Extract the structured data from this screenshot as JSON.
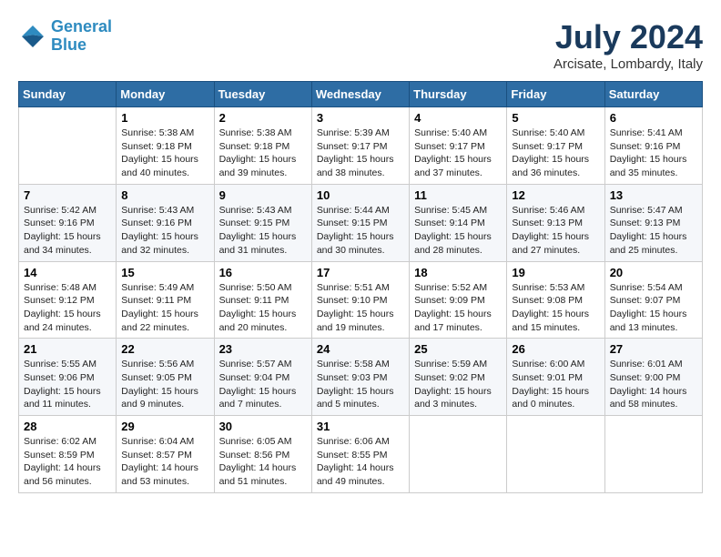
{
  "header": {
    "logo_line1": "General",
    "logo_line2": "Blue",
    "month": "July 2024",
    "location": "Arcisate, Lombardy, Italy"
  },
  "columns": [
    "Sunday",
    "Monday",
    "Tuesday",
    "Wednesday",
    "Thursday",
    "Friday",
    "Saturday"
  ],
  "weeks": [
    [
      {
        "day": "",
        "content": ""
      },
      {
        "day": "1",
        "content": "Sunrise: 5:38 AM\nSunset: 9:18 PM\nDaylight: 15 hours\nand 40 minutes."
      },
      {
        "day": "2",
        "content": "Sunrise: 5:38 AM\nSunset: 9:18 PM\nDaylight: 15 hours\nand 39 minutes."
      },
      {
        "day": "3",
        "content": "Sunrise: 5:39 AM\nSunset: 9:17 PM\nDaylight: 15 hours\nand 38 minutes."
      },
      {
        "day": "4",
        "content": "Sunrise: 5:40 AM\nSunset: 9:17 PM\nDaylight: 15 hours\nand 37 minutes."
      },
      {
        "day": "5",
        "content": "Sunrise: 5:40 AM\nSunset: 9:17 PM\nDaylight: 15 hours\nand 36 minutes."
      },
      {
        "day": "6",
        "content": "Sunrise: 5:41 AM\nSunset: 9:16 PM\nDaylight: 15 hours\nand 35 minutes."
      }
    ],
    [
      {
        "day": "7",
        "content": "Sunrise: 5:42 AM\nSunset: 9:16 PM\nDaylight: 15 hours\nand 34 minutes."
      },
      {
        "day": "8",
        "content": "Sunrise: 5:43 AM\nSunset: 9:16 PM\nDaylight: 15 hours\nand 32 minutes."
      },
      {
        "day": "9",
        "content": "Sunrise: 5:43 AM\nSunset: 9:15 PM\nDaylight: 15 hours\nand 31 minutes."
      },
      {
        "day": "10",
        "content": "Sunrise: 5:44 AM\nSunset: 9:15 PM\nDaylight: 15 hours\nand 30 minutes."
      },
      {
        "day": "11",
        "content": "Sunrise: 5:45 AM\nSunset: 9:14 PM\nDaylight: 15 hours\nand 28 minutes."
      },
      {
        "day": "12",
        "content": "Sunrise: 5:46 AM\nSunset: 9:13 PM\nDaylight: 15 hours\nand 27 minutes."
      },
      {
        "day": "13",
        "content": "Sunrise: 5:47 AM\nSunset: 9:13 PM\nDaylight: 15 hours\nand 25 minutes."
      }
    ],
    [
      {
        "day": "14",
        "content": "Sunrise: 5:48 AM\nSunset: 9:12 PM\nDaylight: 15 hours\nand 24 minutes."
      },
      {
        "day": "15",
        "content": "Sunrise: 5:49 AM\nSunset: 9:11 PM\nDaylight: 15 hours\nand 22 minutes."
      },
      {
        "day": "16",
        "content": "Sunrise: 5:50 AM\nSunset: 9:11 PM\nDaylight: 15 hours\nand 20 minutes."
      },
      {
        "day": "17",
        "content": "Sunrise: 5:51 AM\nSunset: 9:10 PM\nDaylight: 15 hours\nand 19 minutes."
      },
      {
        "day": "18",
        "content": "Sunrise: 5:52 AM\nSunset: 9:09 PM\nDaylight: 15 hours\nand 17 minutes."
      },
      {
        "day": "19",
        "content": "Sunrise: 5:53 AM\nSunset: 9:08 PM\nDaylight: 15 hours\nand 15 minutes."
      },
      {
        "day": "20",
        "content": "Sunrise: 5:54 AM\nSunset: 9:07 PM\nDaylight: 15 hours\nand 13 minutes."
      }
    ],
    [
      {
        "day": "21",
        "content": "Sunrise: 5:55 AM\nSunset: 9:06 PM\nDaylight: 15 hours\nand 11 minutes."
      },
      {
        "day": "22",
        "content": "Sunrise: 5:56 AM\nSunset: 9:05 PM\nDaylight: 15 hours\nand 9 minutes."
      },
      {
        "day": "23",
        "content": "Sunrise: 5:57 AM\nSunset: 9:04 PM\nDaylight: 15 hours\nand 7 minutes."
      },
      {
        "day": "24",
        "content": "Sunrise: 5:58 AM\nSunset: 9:03 PM\nDaylight: 15 hours\nand 5 minutes."
      },
      {
        "day": "25",
        "content": "Sunrise: 5:59 AM\nSunset: 9:02 PM\nDaylight: 15 hours\nand 3 minutes."
      },
      {
        "day": "26",
        "content": "Sunrise: 6:00 AM\nSunset: 9:01 PM\nDaylight: 15 hours\nand 0 minutes."
      },
      {
        "day": "27",
        "content": "Sunrise: 6:01 AM\nSunset: 9:00 PM\nDaylight: 14 hours\nand 58 minutes."
      }
    ],
    [
      {
        "day": "28",
        "content": "Sunrise: 6:02 AM\nSunset: 8:59 PM\nDaylight: 14 hours\nand 56 minutes."
      },
      {
        "day": "29",
        "content": "Sunrise: 6:04 AM\nSunset: 8:57 PM\nDaylight: 14 hours\nand 53 minutes."
      },
      {
        "day": "30",
        "content": "Sunrise: 6:05 AM\nSunset: 8:56 PM\nDaylight: 14 hours\nand 51 minutes."
      },
      {
        "day": "31",
        "content": "Sunrise: 6:06 AM\nSunset: 8:55 PM\nDaylight: 14 hours\nand 49 minutes."
      },
      {
        "day": "",
        "content": ""
      },
      {
        "day": "",
        "content": ""
      },
      {
        "day": "",
        "content": ""
      }
    ]
  ]
}
